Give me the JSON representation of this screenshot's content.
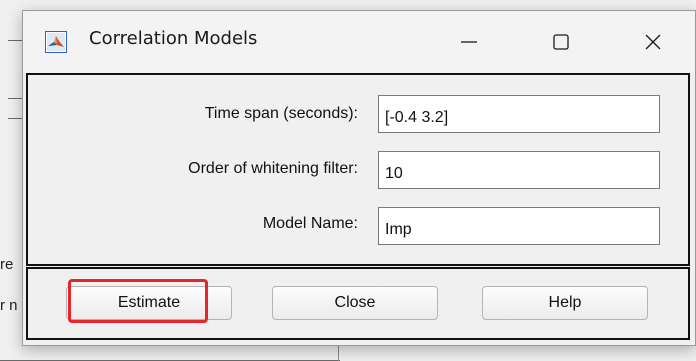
{
  "window": {
    "title": "Correlation Models",
    "app_icon": "matlab-icon",
    "controls": [
      "minimize-icon",
      "maximize-icon",
      "close-icon"
    ]
  },
  "form": {
    "time_span": {
      "label": "Time span (seconds):",
      "value": "[-0.4 3.2]"
    },
    "whitening_order": {
      "label": "Order of whitening filter:",
      "value": "10"
    },
    "model_name": {
      "label": "Model Name:",
      "value": "Imp"
    }
  },
  "buttons": {
    "estimate": "Estimate",
    "close": "Close",
    "help": "Help"
  },
  "background": {
    "fragment_1": "re",
    "fragment_2": "r n"
  },
  "colors": {
    "highlight": "#e5262a",
    "dialog_bg": "#f0f0f0",
    "panel_border": "#111111"
  }
}
